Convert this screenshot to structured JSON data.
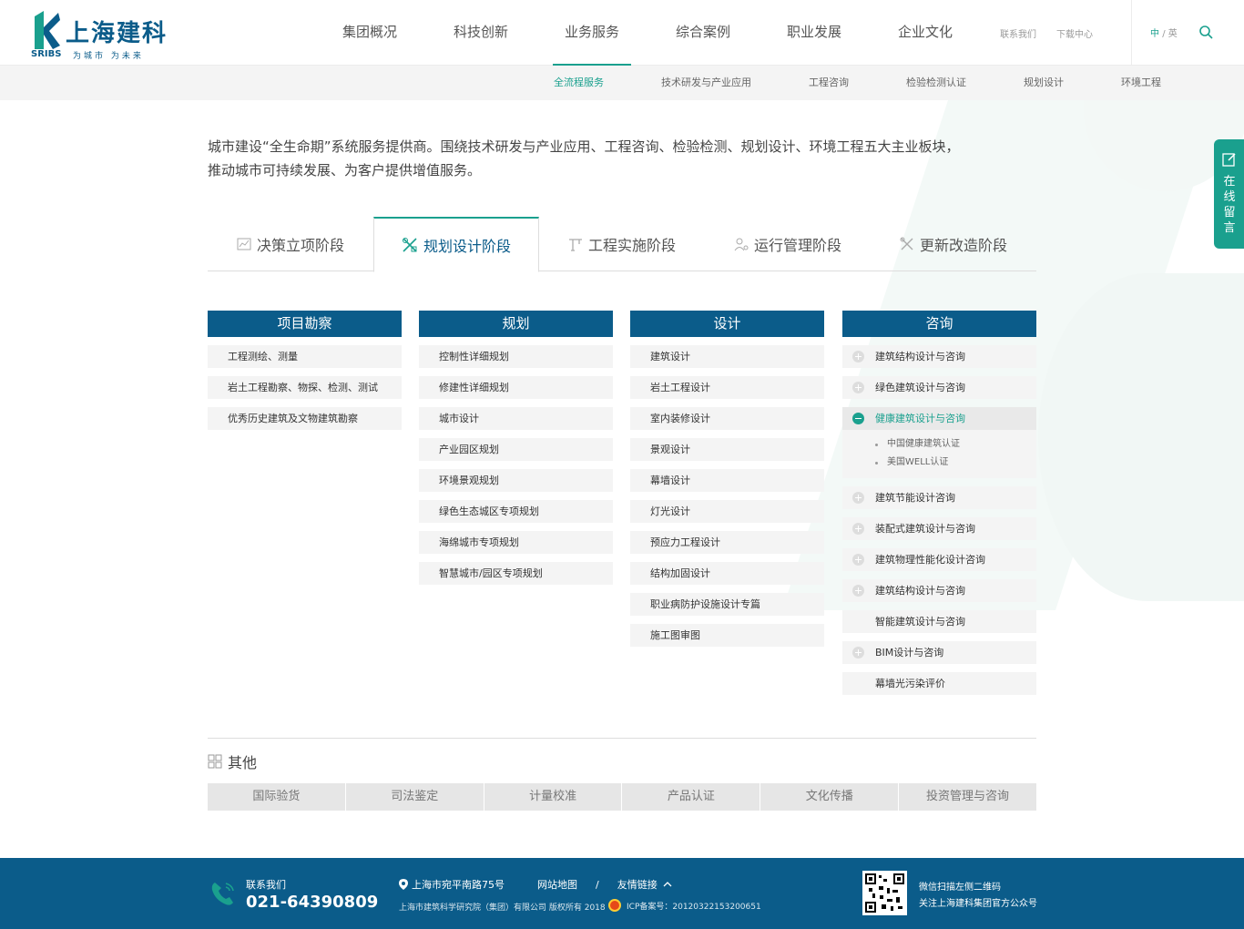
{
  "header": {
    "logo": {
      "cn": "上海建科",
      "en": "SRIBS",
      "slogan": "为城市 为未来"
    },
    "nav": [
      "集团概况",
      "科技创新",
      "业务服务",
      "综合案例",
      "职业发展",
      "企业文化"
    ],
    "active_nav": "业务服务",
    "utility": {
      "contact": "联系我们",
      "download": "下载中心"
    },
    "lang": {
      "zh": "中",
      "sep": "/",
      "en": "英"
    }
  },
  "sub_nav": {
    "items": [
      "全流程服务",
      "技术研发与产业应用",
      "工程咨询",
      "检验检测认证",
      "规划设计",
      "环境工程"
    ],
    "active": "全流程服务"
  },
  "intro": {
    "line1": "城市建设“全生命期”系统服务提供商。围绕技术研发与产业应用、工程咨询、检验检测、规划设计、环境工程五大主业板块，",
    "line2": "推动城市可持续发展、为客户提供增值服务。"
  },
  "stages": {
    "tabs": [
      "决策立项阶段",
      "规划设计阶段",
      "工程实施阶段",
      "运行管理阶段",
      "更新改造阶段"
    ],
    "active": "规划设计阶段"
  },
  "columns": {
    "survey": {
      "title": "项目勘察",
      "items": [
        "工程测绘、测量",
        "岩土工程勘察、物探、检测、测试",
        "优秀历史建筑及文物建筑勘察"
      ]
    },
    "planning": {
      "title": "规划",
      "items": [
        "控制性详细规划",
        "修建性详细规划",
        "城市设计",
        "产业园区规划",
        "环境景观规划",
        "绿色生态城区专项规划",
        "海绵城市专项规划",
        "智慧城市/园区专项规划"
      ]
    },
    "design": {
      "title": "设计",
      "items": [
        "建筑设计",
        "岩土工程设计",
        "室内装修设计",
        "景观设计",
        "幕墙设计",
        "灯光设计",
        "预应力工程设计",
        "结构加固设计",
        "职业病防护设施设计专篇",
        "施工图审图"
      ]
    },
    "consulting": {
      "title": "咨询",
      "items": [
        "建筑结构设计与咨询",
        "绿色建筑设计与咨询",
        "健康建筑设计与咨询",
        "建筑节能设计咨询",
        "装配式建筑设计与咨询",
        "建筑物理性能化设计咨询",
        "建筑结构设计与咨询",
        "智能建筑设计与咨询",
        "BIM设计与咨询",
        "幕墙光污染评价"
      ],
      "expanded_item": "健康建筑设计与咨询",
      "expanded_sub": [
        "中国健康建筑认证",
        "美国WELL认证"
      ]
    }
  },
  "other": {
    "title": "其他",
    "items": [
      "国际验货",
      "司法鉴定",
      "计量校准",
      "产品认证",
      "文化传播",
      "投资管理与咨询"
    ]
  },
  "side_float": {
    "label": "在线留言"
  },
  "footer": {
    "contact_label": "联系我们",
    "phone": "021-64390809",
    "address": "上海市宛平南路75号",
    "sitemap": "网站地图",
    "sep": "/",
    "friend_links": "友情链接",
    "copyright": "上海市建筑科学研究院（集团）有限公司 版权所有 2018",
    "icp": "ICP备案号：20120322153200651",
    "qr_line1": "微信扫描左侧二维码",
    "qr_line2": "关注上海建科集团官方公众号"
  },
  "colors": {
    "brand_blue": "#0b5c8a",
    "accent_green": "#1aa08e",
    "light_gray": "#f4f4f4"
  }
}
